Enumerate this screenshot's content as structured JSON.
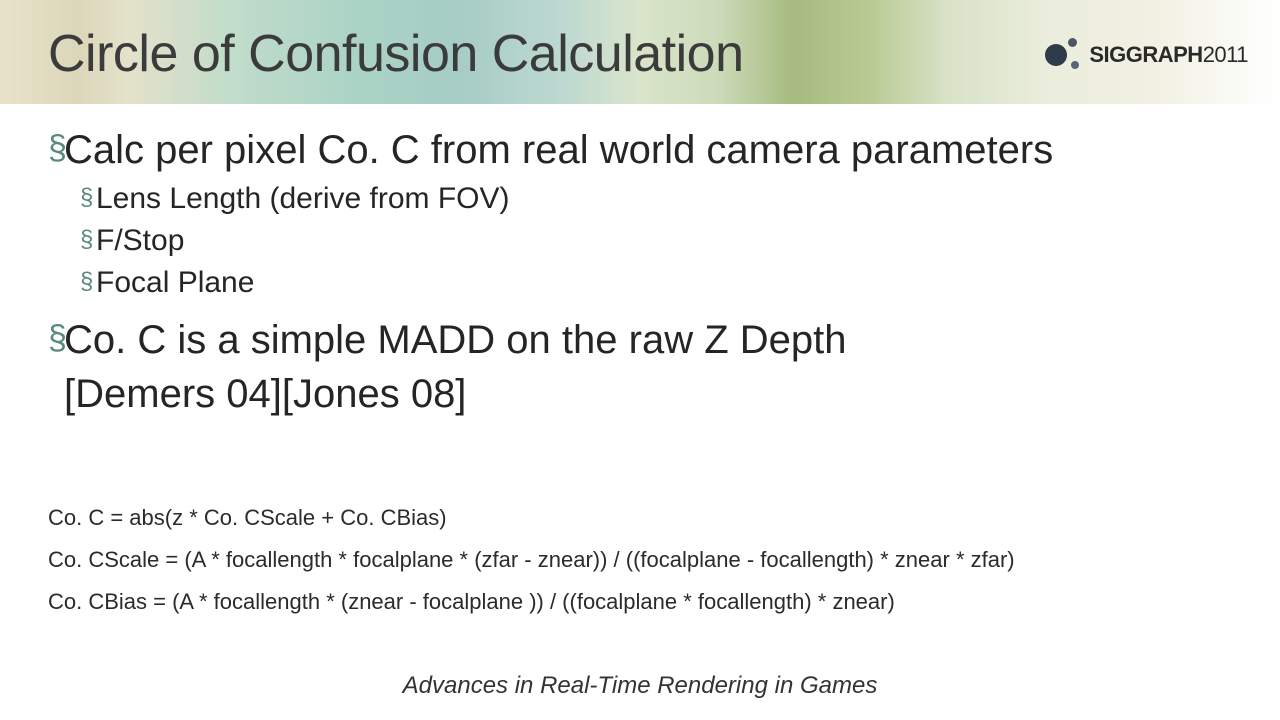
{
  "header": {
    "title": "Circle of Confusion Calculation",
    "logo_brand": "SIGGRAPH",
    "logo_year": "2011"
  },
  "bullets": {
    "b1a": "Calc per pixel Co. C from real world camera parameters",
    "b2a": "Lens Length (derive from FOV)",
    "b2b": "F/Stop",
    "b2c": "Focal Plane",
    "b1b_line1": "Co. C is a simple MADD on the raw Z Depth",
    "b1b_line2": "[Demers 04][Jones 08]"
  },
  "equations": {
    "eq1": "Co. C = abs(z * Co. CScale + Co. CBias)",
    "eq2": "Co. CScale = (A * focallength * focalplane * (zfar - znear)) / ((focalplane - focallength) * znear * zfar)",
    "eq3": "Co. CBias = (A * focallength * (znear - focalplane )) / ((focalplane * focallength) * znear)"
  },
  "footer": "Advances in Real-Time Rendering in Games"
}
